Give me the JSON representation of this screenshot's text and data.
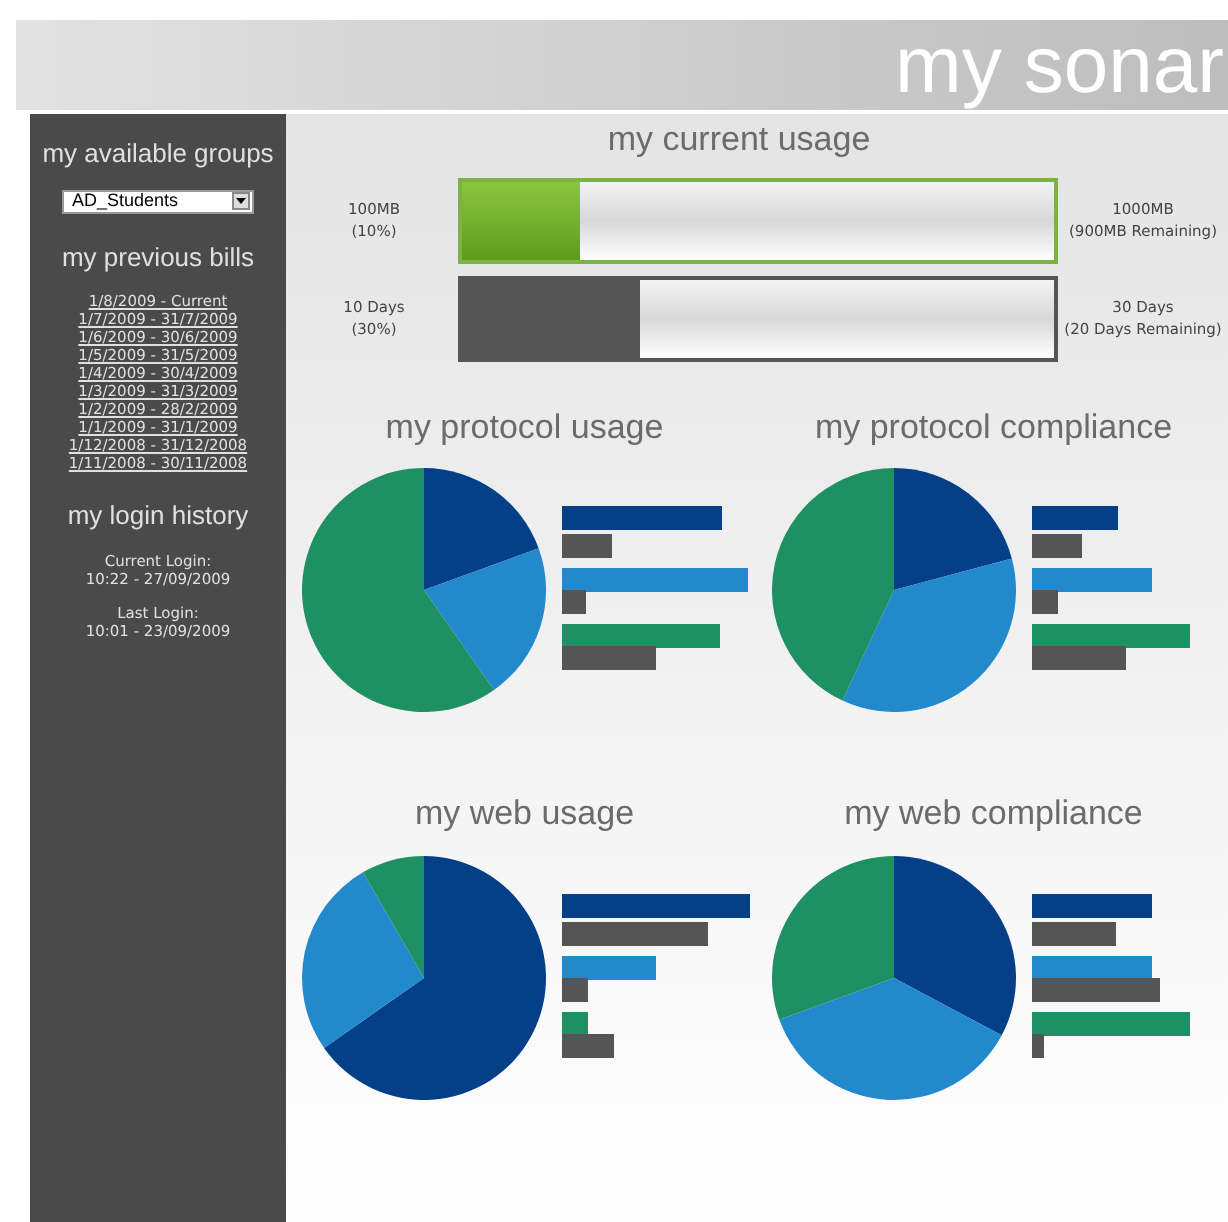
{
  "header": {
    "title": "my sonar"
  },
  "sidebar": {
    "groups_heading": "my available groups",
    "group_select": {
      "value": "AD_Students"
    },
    "bills_heading": "my previous bills",
    "bills": [
      "1/8/2009 - Current",
      "1/7/2009 - 31/7/2009",
      "1/6/2009 - 30/6/2009",
      "1/5/2009 - 31/5/2009",
      "1/4/2009 - 30/4/2009",
      "1/3/2009 - 31/3/2009",
      "1/2/2009 - 28/2/2009",
      "1/1/2009 - 31/1/2009",
      "1/12/2008 - 31/12/2008",
      "1/11/2008 - 30/11/2008"
    ],
    "login_heading": "my login history",
    "logins": [
      {
        "label": "Current Login:",
        "time": "10:22 - 27/09/2009"
      },
      {
        "label": "Last Login:",
        "time": "10:01 - 23/09/2009"
      }
    ]
  },
  "usage": {
    "title": "my current usage",
    "meters": [
      {
        "kind": "data",
        "used": "100MB",
        "used_share": "(10%)",
        "total": "1000MB",
        "remaining": "(900MB Remaining)",
        "level": 0.2
      },
      {
        "kind": "days",
        "used": "10 Days",
        "used_share": "(30%)",
        "total": "30 Days",
        "remaining": "(20 Days Remaining)",
        "level": 0.3
      }
    ]
  },
  "charts": [
    {
      "title": "my protocol usage"
    },
    {
      "title": "my protocol compliance"
    },
    {
      "title": "my web usage"
    },
    {
      "title": "my web compliance"
    }
  ]
}
